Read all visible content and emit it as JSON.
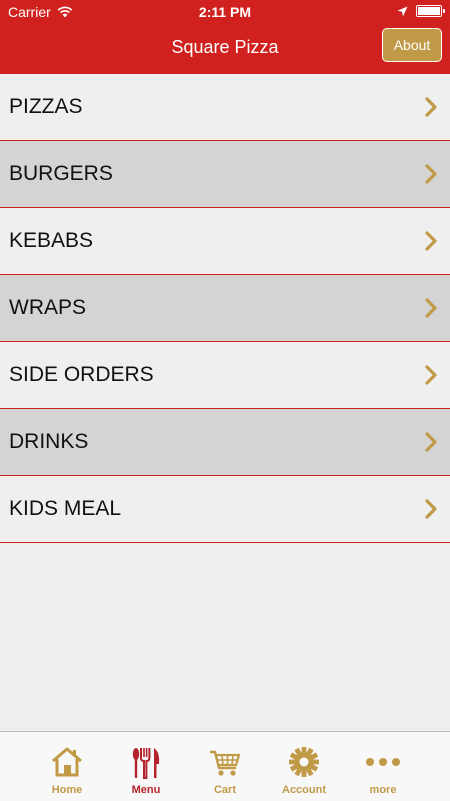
{
  "status_bar": {
    "carrier": "Carrier",
    "time": "2:11 PM"
  },
  "nav": {
    "title": "Square Pizza",
    "about_label": "About"
  },
  "menu": {
    "items": [
      {
        "label": "PIZZAS"
      },
      {
        "label": "BURGERS"
      },
      {
        "label": "KEBABS"
      },
      {
        "label": "WRAPS"
      },
      {
        "label": "SIDE ORDERS"
      },
      {
        "label": "DRINKS"
      },
      {
        "label": "KIDS MEAL"
      }
    ]
  },
  "tabs": [
    {
      "label": "Home",
      "icon": "house-icon"
    },
    {
      "label": "Menu",
      "icon": "cutlery-icon"
    },
    {
      "label": "Cart",
      "icon": "cart-icon"
    },
    {
      "label": "Account",
      "icon": "gear-icon"
    },
    {
      "label": "more",
      "icon": "more-dots-icon"
    }
  ],
  "colors": {
    "brand_red": "#d0211f",
    "accent_gold": "#c19a47",
    "active_tab": "#b2232b",
    "row_dark": "#d4d4d4",
    "row_light": "#efeff0"
  }
}
